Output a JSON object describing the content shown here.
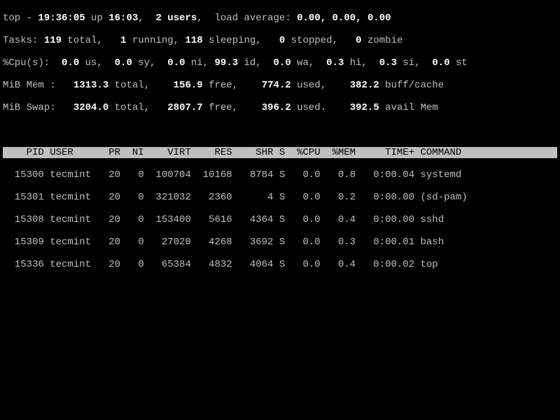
{
  "summary": {
    "line1_pre": "top - ",
    "time": "19:36:05",
    "line1_mid1": " up ",
    "uptime": "16:03",
    "line1_mid2": ",  ",
    "users": "2 users",
    "line1_mid3": ",  load average: ",
    "load": "0.00, 0.00, 0.00",
    "tasks_pre": "Tasks: ",
    "tasks_total": "119 ",
    "tasks_total_lbl": "total,   ",
    "tasks_run": "1 ",
    "tasks_run_lbl": "running, ",
    "tasks_sleep": "118 ",
    "tasks_sleep_lbl": "sleeping,   ",
    "tasks_stop": "0 ",
    "tasks_stop_lbl": "stopped,   ",
    "tasks_zomb": "0 ",
    "tasks_zomb_lbl": "zombie",
    "cpu_pre": "%Cpu(s):  ",
    "cpu_us": "0.0 ",
    "cpu_us_lbl": "us,  ",
    "cpu_sy": "0.0 ",
    "cpu_sy_lbl": "sy,  ",
    "cpu_ni": "0.0 ",
    "cpu_ni_lbl": "ni, ",
    "cpu_id": "99.3 ",
    "cpu_id_lbl": "id,  ",
    "cpu_wa": "0.0 ",
    "cpu_wa_lbl": "wa,  ",
    "cpu_hi": "0.3 ",
    "cpu_hi_lbl": "hi,  ",
    "cpu_si": "0.3 ",
    "cpu_si_lbl": "si,  ",
    "cpu_st": "0.0 ",
    "cpu_st_lbl": "st",
    "mem_pre": "MiB Mem :   ",
    "mem_total": "1313.3 ",
    "mem_total_lbl": "total,    ",
    "mem_free": "156.9 ",
    "mem_free_lbl": "free,    ",
    "mem_used": "774.2 ",
    "mem_used_lbl": "used,    ",
    "mem_buff": "382.2 ",
    "mem_buff_lbl": "buff/cache",
    "swap_pre": "MiB Swap:   ",
    "swap_total": "3204.0 ",
    "swap_total_lbl": "total,   ",
    "swap_free": "2807.7 ",
    "swap_free_lbl": "free,    ",
    "swap_used": "396.2 ",
    "swap_used_lbl": "used.    ",
    "swap_avail": "392.5 ",
    "swap_avail_lbl": "avail Mem"
  },
  "header": "    PID USER      PR  NI    VIRT    RES    SHR S  %CPU  %MEM     TIME+ COMMAND                                       ",
  "rows": [
    "  15300 tecmint   20   0  100704  10168   8784 S   0.0   0.8   0:00.04 systemd",
    "  15301 tecmint   20   0  321032   2360      4 S   0.0   0.2   0:00.00 (sd-pam)",
    "  15308 tecmint   20   0  153400   5616   4364 S   0.0   0.4   0:00.00 sshd",
    "  15309 tecmint   20   0   27020   4268   3692 S   0.0   0.3   0:00.01 bash",
    "  15336 tecmint   20   0   65384   4832   4064 S   0.0   0.4   0:00.02 top"
  ]
}
